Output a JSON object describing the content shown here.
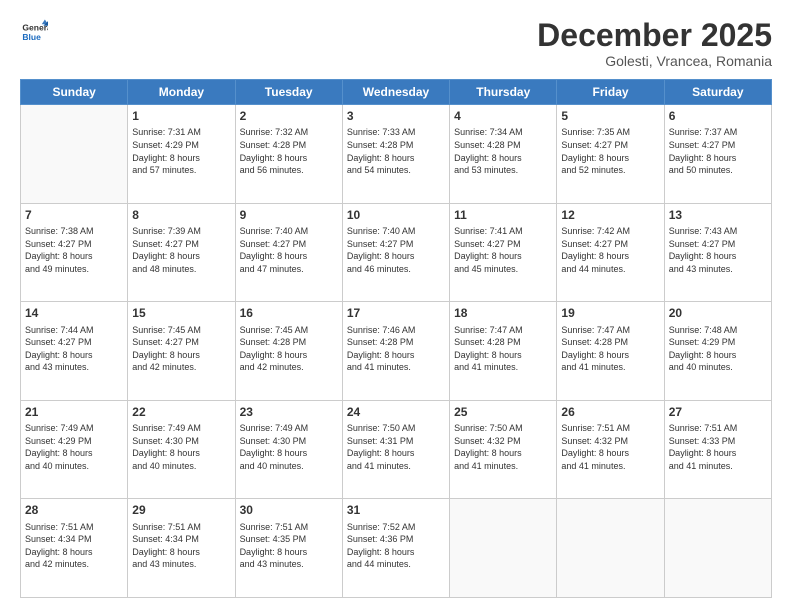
{
  "logo": {
    "line1": "General",
    "line2": "Blue"
  },
  "header": {
    "month": "December 2025",
    "location": "Golesti, Vrancea, Romania"
  },
  "weekdays": [
    "Sunday",
    "Monday",
    "Tuesday",
    "Wednesday",
    "Thursday",
    "Friday",
    "Saturday"
  ],
  "weeks": [
    [
      {
        "day": "",
        "info": ""
      },
      {
        "day": "1",
        "info": "Sunrise: 7:31 AM\nSunset: 4:29 PM\nDaylight: 8 hours\nand 57 minutes."
      },
      {
        "day": "2",
        "info": "Sunrise: 7:32 AM\nSunset: 4:28 PM\nDaylight: 8 hours\nand 56 minutes."
      },
      {
        "day": "3",
        "info": "Sunrise: 7:33 AM\nSunset: 4:28 PM\nDaylight: 8 hours\nand 54 minutes."
      },
      {
        "day": "4",
        "info": "Sunrise: 7:34 AM\nSunset: 4:28 PM\nDaylight: 8 hours\nand 53 minutes."
      },
      {
        "day": "5",
        "info": "Sunrise: 7:35 AM\nSunset: 4:27 PM\nDaylight: 8 hours\nand 52 minutes."
      },
      {
        "day": "6",
        "info": "Sunrise: 7:37 AM\nSunset: 4:27 PM\nDaylight: 8 hours\nand 50 minutes."
      }
    ],
    [
      {
        "day": "7",
        "info": "Sunrise: 7:38 AM\nSunset: 4:27 PM\nDaylight: 8 hours\nand 49 minutes."
      },
      {
        "day": "8",
        "info": "Sunrise: 7:39 AM\nSunset: 4:27 PM\nDaylight: 8 hours\nand 48 minutes."
      },
      {
        "day": "9",
        "info": "Sunrise: 7:40 AM\nSunset: 4:27 PM\nDaylight: 8 hours\nand 47 minutes."
      },
      {
        "day": "10",
        "info": "Sunrise: 7:40 AM\nSunset: 4:27 PM\nDaylight: 8 hours\nand 46 minutes."
      },
      {
        "day": "11",
        "info": "Sunrise: 7:41 AM\nSunset: 4:27 PM\nDaylight: 8 hours\nand 45 minutes."
      },
      {
        "day": "12",
        "info": "Sunrise: 7:42 AM\nSunset: 4:27 PM\nDaylight: 8 hours\nand 44 minutes."
      },
      {
        "day": "13",
        "info": "Sunrise: 7:43 AM\nSunset: 4:27 PM\nDaylight: 8 hours\nand 43 minutes."
      }
    ],
    [
      {
        "day": "14",
        "info": "Sunrise: 7:44 AM\nSunset: 4:27 PM\nDaylight: 8 hours\nand 43 minutes."
      },
      {
        "day": "15",
        "info": "Sunrise: 7:45 AM\nSunset: 4:27 PM\nDaylight: 8 hours\nand 42 minutes."
      },
      {
        "day": "16",
        "info": "Sunrise: 7:45 AM\nSunset: 4:28 PM\nDaylight: 8 hours\nand 42 minutes."
      },
      {
        "day": "17",
        "info": "Sunrise: 7:46 AM\nSunset: 4:28 PM\nDaylight: 8 hours\nand 41 minutes."
      },
      {
        "day": "18",
        "info": "Sunrise: 7:47 AM\nSunset: 4:28 PM\nDaylight: 8 hours\nand 41 minutes."
      },
      {
        "day": "19",
        "info": "Sunrise: 7:47 AM\nSunset: 4:28 PM\nDaylight: 8 hours\nand 41 minutes."
      },
      {
        "day": "20",
        "info": "Sunrise: 7:48 AM\nSunset: 4:29 PM\nDaylight: 8 hours\nand 40 minutes."
      }
    ],
    [
      {
        "day": "21",
        "info": "Sunrise: 7:49 AM\nSunset: 4:29 PM\nDaylight: 8 hours\nand 40 minutes."
      },
      {
        "day": "22",
        "info": "Sunrise: 7:49 AM\nSunset: 4:30 PM\nDaylight: 8 hours\nand 40 minutes."
      },
      {
        "day": "23",
        "info": "Sunrise: 7:49 AM\nSunset: 4:30 PM\nDaylight: 8 hours\nand 40 minutes."
      },
      {
        "day": "24",
        "info": "Sunrise: 7:50 AM\nSunset: 4:31 PM\nDaylight: 8 hours\nand 41 minutes."
      },
      {
        "day": "25",
        "info": "Sunrise: 7:50 AM\nSunset: 4:32 PM\nDaylight: 8 hours\nand 41 minutes."
      },
      {
        "day": "26",
        "info": "Sunrise: 7:51 AM\nSunset: 4:32 PM\nDaylight: 8 hours\nand 41 minutes."
      },
      {
        "day": "27",
        "info": "Sunrise: 7:51 AM\nSunset: 4:33 PM\nDaylight: 8 hours\nand 41 minutes."
      }
    ],
    [
      {
        "day": "28",
        "info": "Sunrise: 7:51 AM\nSunset: 4:34 PM\nDaylight: 8 hours\nand 42 minutes."
      },
      {
        "day": "29",
        "info": "Sunrise: 7:51 AM\nSunset: 4:34 PM\nDaylight: 8 hours\nand 43 minutes."
      },
      {
        "day": "30",
        "info": "Sunrise: 7:51 AM\nSunset: 4:35 PM\nDaylight: 8 hours\nand 43 minutes."
      },
      {
        "day": "31",
        "info": "Sunrise: 7:52 AM\nSunset: 4:36 PM\nDaylight: 8 hours\nand 44 minutes."
      },
      {
        "day": "",
        "info": ""
      },
      {
        "day": "",
        "info": ""
      },
      {
        "day": "",
        "info": ""
      }
    ]
  ]
}
